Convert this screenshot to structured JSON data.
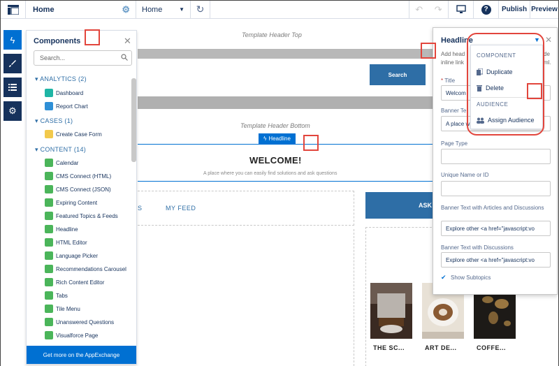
{
  "topbar": {
    "page_name": "Home",
    "page_select": "Home",
    "publish_label": "Publish",
    "preview_label": "Preview"
  },
  "canvas": {
    "header_top_label": "Template Header Top",
    "search_button": "Search",
    "header_bottom_label": "Template Header Bottom",
    "headline_tag": "Headline",
    "welcome_title": "WELCOME!",
    "welcome_subtitle": "A place where you can easily find solutions and ask questions",
    "tab_partial": "S",
    "tab_my_feed": "MY FEED",
    "ask_button_partial": "ASK",
    "cards": [
      {
        "caption": "THE SC..."
      },
      {
        "caption": "ART DE..."
      },
      {
        "caption": "COFFE..."
      }
    ]
  },
  "rail": {
    "items": [
      {
        "icon": "lightning-icon"
      },
      {
        "icon": "brush-icon"
      },
      {
        "icon": "list-icon"
      },
      {
        "icon": "gear-icon"
      }
    ]
  },
  "components": {
    "title": "Components",
    "search_placeholder": "Search...",
    "categories": [
      {
        "label": "ANALYTICS (2)",
        "items": [
          "Dashboard",
          "Report Chart"
        ]
      },
      {
        "label": "CASES (1)",
        "items": [
          "Create Case Form"
        ]
      },
      {
        "label": "CONTENT (14)",
        "items": [
          "Calendar",
          "CMS Connect (HTML)",
          "CMS Connect (JSON)",
          "Expiring Content",
          "Featured Topics & Feeds",
          "Headline",
          "HTML Editor",
          "Language Picker",
          "Recommendations Carousel",
          "Rich Content Editor",
          "Tabs",
          "Tile Menu",
          "Unanswered Questions",
          "Visualforce Page"
        ]
      }
    ],
    "footer": "Get more on the AppExchange"
  },
  "props": {
    "title": "Headline",
    "desc_line1": "Add head",
    "desc_line2": "inline link",
    "desc_right1": "de",
    "desc_right2": "ml.",
    "title_label": "Title",
    "title_value": "Welcom",
    "banner_label": "Banner Te",
    "banner_value": "A place w",
    "page_type_label": "Page Type",
    "unique_label": "Unique Name or ID",
    "articles_label": "Banner Text with Articles and Discussions",
    "articles_value": "Explore other <a href=\"javascript:vo",
    "discussions_label": "Banner Text with Discussions",
    "discussions_value": "Explore other <a href=\"javascript:vo",
    "show_subtopics": "Show Subtopics"
  },
  "menu": {
    "section1": "COMPONENT",
    "duplicate": "Duplicate",
    "delete": "Delete",
    "section2": "AUDIENCE",
    "assign": "Assign Audience"
  },
  "colors": {
    "brand_blue": "#0070d2",
    "navy": "#16325c",
    "search_blue": "#2e6ea6",
    "annotation_red": "#e2453c"
  }
}
